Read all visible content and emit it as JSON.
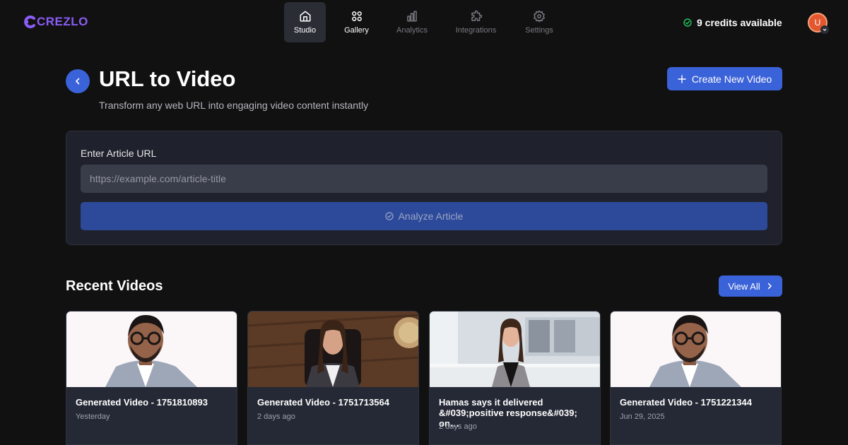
{
  "brand": {
    "name": "CREZLO",
    "accent": "#8b5cf6"
  },
  "nav": {
    "items": [
      {
        "label": "Studio",
        "icon": "home-icon",
        "state": "active"
      },
      {
        "label": "Gallery",
        "icon": "grid-icon",
        "state": "bright"
      },
      {
        "label": "Analytics",
        "icon": "bar-chart-icon",
        "state": "dim"
      },
      {
        "label": "Integrations",
        "icon": "puzzle-icon",
        "state": "dim"
      },
      {
        "label": "Settings",
        "icon": "gear-icon",
        "state": "dim"
      }
    ]
  },
  "credits": {
    "text": "9 credits available",
    "icon": "check-circle-icon",
    "color": "#22c55e"
  },
  "user": {
    "initial": "U",
    "color": "#e4572e"
  },
  "header": {
    "title": "URL to Video",
    "subtitle": "Transform any web URL into engaging video content instantly",
    "create_label": "Create New Video"
  },
  "url_form": {
    "label": "Enter Article URL",
    "placeholder": "https://example.com/article-title",
    "value": "",
    "analyze_label": "Analyze Article"
  },
  "recent": {
    "title": "Recent Videos",
    "view_all_label": "View All",
    "videos": [
      {
        "title": "Generated Video - 1751810893",
        "date": "Yesterday",
        "thumbnail": "man-with-glasses"
      },
      {
        "title": "Generated Video - 1751713564",
        "date": "2 days ago",
        "thumbnail": "woman-at-desk"
      },
      {
        "title": "Hamas says it delivered &#039;positive response&#039; on…",
        "date": "2 days ago",
        "thumbnail": "woman-in-kitchen"
      },
      {
        "title": "Generated Video - 1751221344",
        "date": "Jun 29, 2025",
        "thumbnail": "man-with-glasses"
      }
    ]
  },
  "colors": {
    "primary": "#3b63d9",
    "background": "#111112",
    "card": "#1f222c"
  }
}
